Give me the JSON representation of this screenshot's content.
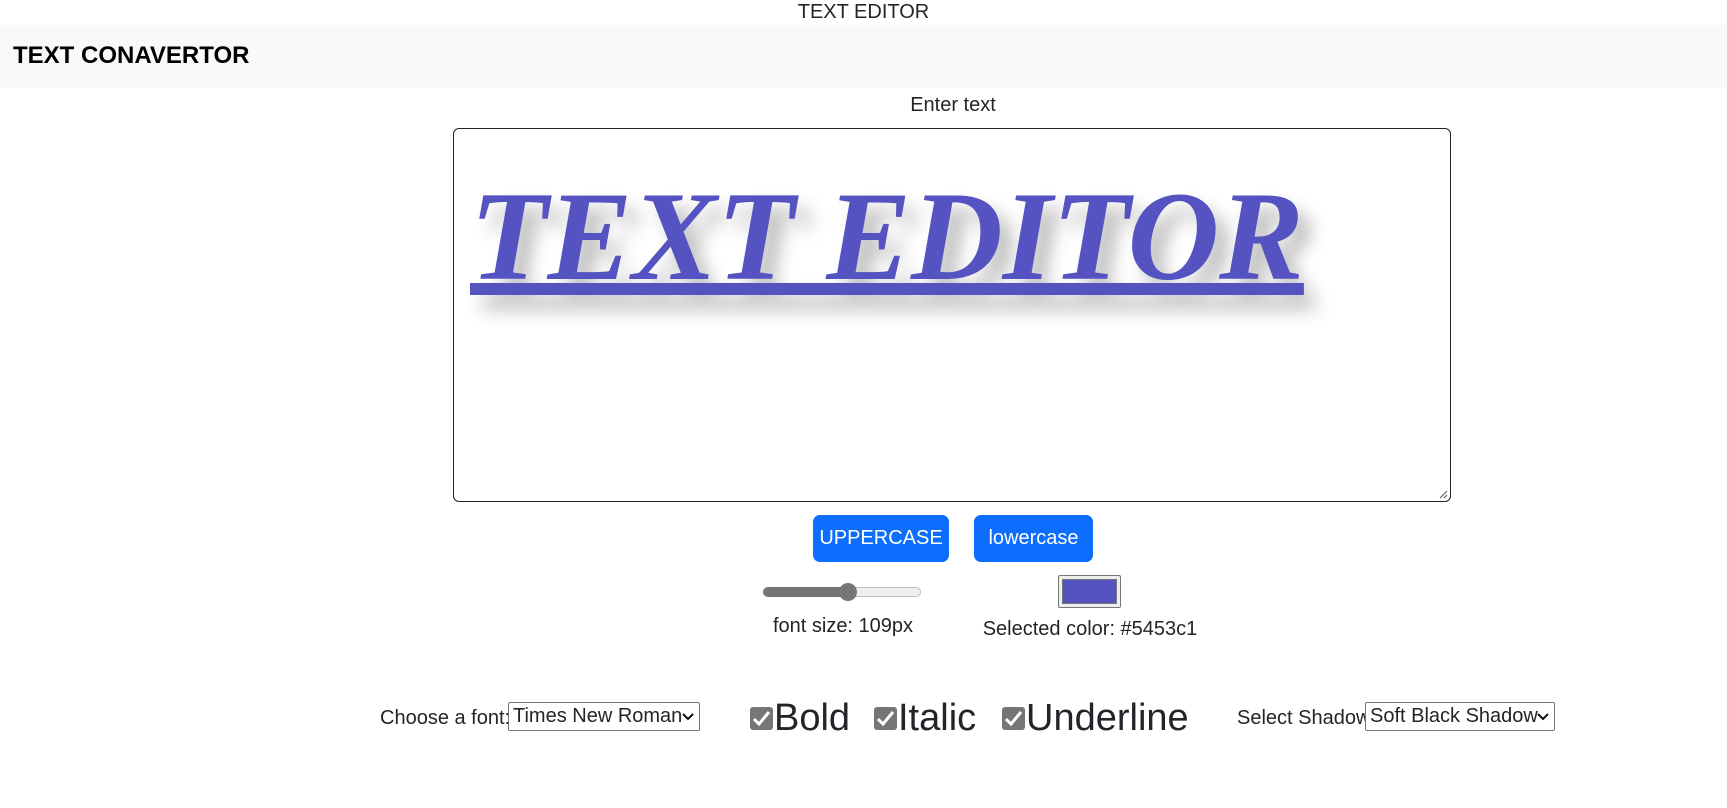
{
  "page": {
    "title": "TEXT EDITOR"
  },
  "navbar": {
    "brand": "TEXT CONAVERTOR"
  },
  "editor": {
    "label": "Enter text",
    "text": "TEXT EDITOR",
    "text_color": "#5453c1"
  },
  "buttons": {
    "uppercase": "UPPERCASE",
    "lowercase": "lowercase"
  },
  "font_size": {
    "label": "font size: 109px",
    "value": 109,
    "slider_fraction": 0.53
  },
  "color": {
    "label": "Selected color: #5453c1",
    "value": "#5453c1"
  },
  "font_select": {
    "label": "Choose a font:",
    "selected": "Times New Roman"
  },
  "styles": {
    "bold": {
      "label": "Bold",
      "checked": true
    },
    "italic": {
      "label": "Italic",
      "checked": true
    },
    "underline": {
      "label": "Underline",
      "checked": true
    }
  },
  "shadow_select": {
    "label": "Select Shadow",
    "selected": "Soft Black Shadow"
  }
}
